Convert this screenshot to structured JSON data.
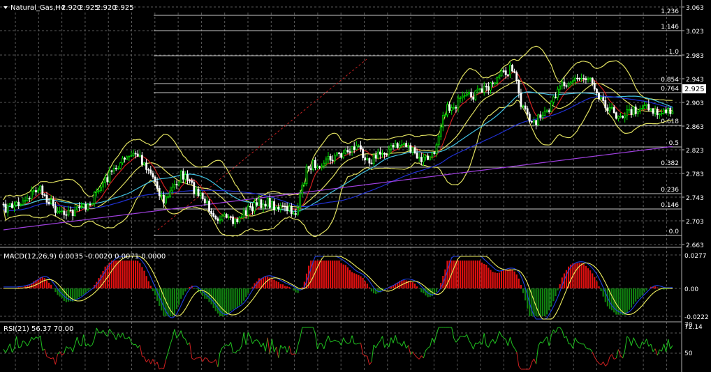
{
  "header": {
    "arrow_icon": "triangle-down-icon",
    "symbol_text": "Natural_Gas,H4",
    "ohlc": [
      "2.920",
      "2.925",
      "2.920",
      "2.925"
    ]
  },
  "price_axis": {
    "labels": [
      "3.063",
      "3.023",
      "2.983",
      "2.943",
      "2.903",
      "2.863",
      "2.823",
      "2.783",
      "2.743",
      "2.703",
      "2.663"
    ],
    "current_price": "2.925"
  },
  "fibonacci": {
    "levels": [
      "1.236",
      "1.146",
      "1.0",
      "0.854",
      "0.764",
      "0.618",
      "0.5",
      "0.382",
      "0.236",
      "0.146",
      "0.0"
    ]
  },
  "macd_panel": {
    "label": "MACD(12,26,9) 0.0035 -0.0020 0.0071 0.0000",
    "axis_labels": [
      "0.0277",
      "0.00",
      "-0.0222"
    ]
  },
  "rsi_panel": {
    "label": "RSI(21) 56.37 70.00",
    "axis_labels": [
      "72.14",
      "70",
      "50"
    ]
  },
  "colors": {
    "background": "#000000",
    "grid": "#5a5a5a",
    "bull_candle": "#00e000",
    "bear_candle": "#ffffff",
    "fib_line": "#c8c8c8",
    "bollinger": "#e0e060",
    "ma_fast": "#d02020",
    "ma_mid": "#40c0e0",
    "ma_slow": "#2030d0",
    "ma_long": "#a040e0",
    "macd_positive": "#e01010",
    "macd_negative": "#108010",
    "macd_signal": "#f0f060",
    "macd_main": "#2040e0",
    "rsi_up": "#20c020",
    "rsi_down": "#d02020"
  }
}
